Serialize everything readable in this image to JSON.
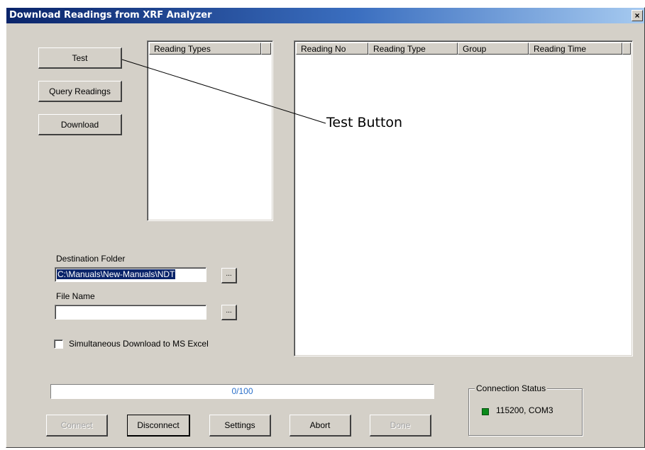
{
  "window": {
    "title": "Download Readings from XRF Analyzer",
    "close_glyph": "×"
  },
  "actions": {
    "test_label": "Test",
    "query_label": "Query Readings",
    "download_label": "Download"
  },
  "reading_types": {
    "header": "Reading Types",
    "items": []
  },
  "readings_table": {
    "columns": [
      "Reading No",
      "Reading Type",
      "Group",
      "Reading Time"
    ],
    "rows": []
  },
  "destination": {
    "label": "Destination Folder",
    "value": "C:\\Manuals\\New-Manuals\\NDT",
    "browse_label": "..."
  },
  "file_name": {
    "label": "File Name",
    "value": "",
    "browse_label": "..."
  },
  "excel_option": {
    "label": "Simultaneous Download to MS Excel",
    "checked": false
  },
  "progress": {
    "text": "0/100",
    "fraction": 0.0
  },
  "bottom_buttons": {
    "connect": "Connect",
    "disconnect": "Disconnect",
    "settings": "Settings",
    "abort": "Abort",
    "done": "Done"
  },
  "connection_status": {
    "title": "Connection Status",
    "value": "115200, COM3",
    "indicator_color": "#0a8a1a"
  },
  "annotation": {
    "text": "Test Button"
  }
}
